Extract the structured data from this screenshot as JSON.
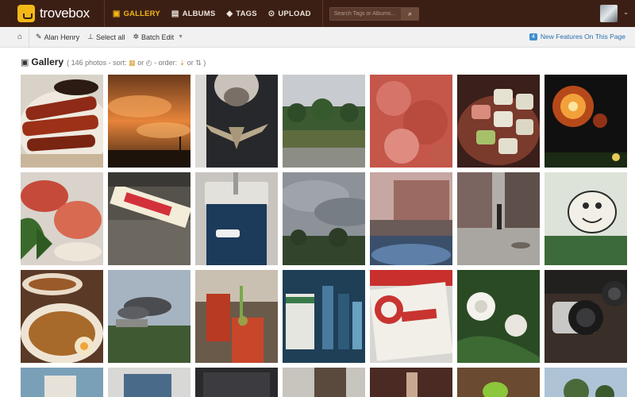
{
  "app": {
    "brand": "trovebox"
  },
  "nav": {
    "items": [
      {
        "label": "GALLERY",
        "icon": "picture-icon",
        "active": true
      },
      {
        "label": "ALBUMS",
        "icon": "albums-icon",
        "active": false
      },
      {
        "label": "TAGS",
        "icon": "tags-icon",
        "active": false
      },
      {
        "label": "UPLOAD",
        "icon": "upload-icon",
        "active": false
      }
    ]
  },
  "search": {
    "placeholder": "Search Tags or Albums..."
  },
  "subbar": {
    "user": "Alan Henry",
    "select_all": "Select all",
    "batch_edit": "Batch Edit",
    "new_features_count": "4",
    "new_features_label": "New Features On This Page"
  },
  "gallery": {
    "title": "Gallery",
    "meta_start": "( 146 photos - sort:",
    "meta_or1": "or",
    "meta_order": "- order:",
    "meta_or2": "or",
    "meta_end": ")"
  },
  "colors": {
    "topbar": "#3c1f14",
    "accent": "#f3b817",
    "link": "#2a6fb0"
  },
  "photos": [
    {
      "subject": "bacon-plate"
    },
    {
      "subject": "orange-sunset-sky"
    },
    {
      "subject": "shirt-emblem"
    },
    {
      "subject": "city-park-trees"
    },
    {
      "subject": "pink-food-closeup"
    },
    {
      "subject": "sushi-plate"
    },
    {
      "subject": "fireworks"
    },
    {
      "subject": "salad-dish"
    },
    {
      "subject": "candy-bar"
    },
    {
      "subject": "blue-gadget"
    },
    {
      "subject": "cloudy-sky"
    },
    {
      "subject": "building-street"
    },
    {
      "subject": "urban-sidewalk"
    },
    {
      "subject": "cartoon-mural"
    },
    {
      "subject": "ramen-bowls"
    },
    {
      "subject": "smoke-sky"
    },
    {
      "subject": "cocktail-glass"
    },
    {
      "subject": "bar-bottles"
    },
    {
      "subject": "red-shop-sign"
    },
    {
      "subject": "white-rose"
    },
    {
      "subject": "camera-lens"
    },
    {
      "subject": "room-interior"
    },
    {
      "subject": "desk-monitor"
    },
    {
      "subject": "dark-screen"
    },
    {
      "subject": "shop-window"
    },
    {
      "subject": "wine-glass"
    },
    {
      "subject": "android-figure"
    },
    {
      "subject": "trees-sky"
    }
  ]
}
